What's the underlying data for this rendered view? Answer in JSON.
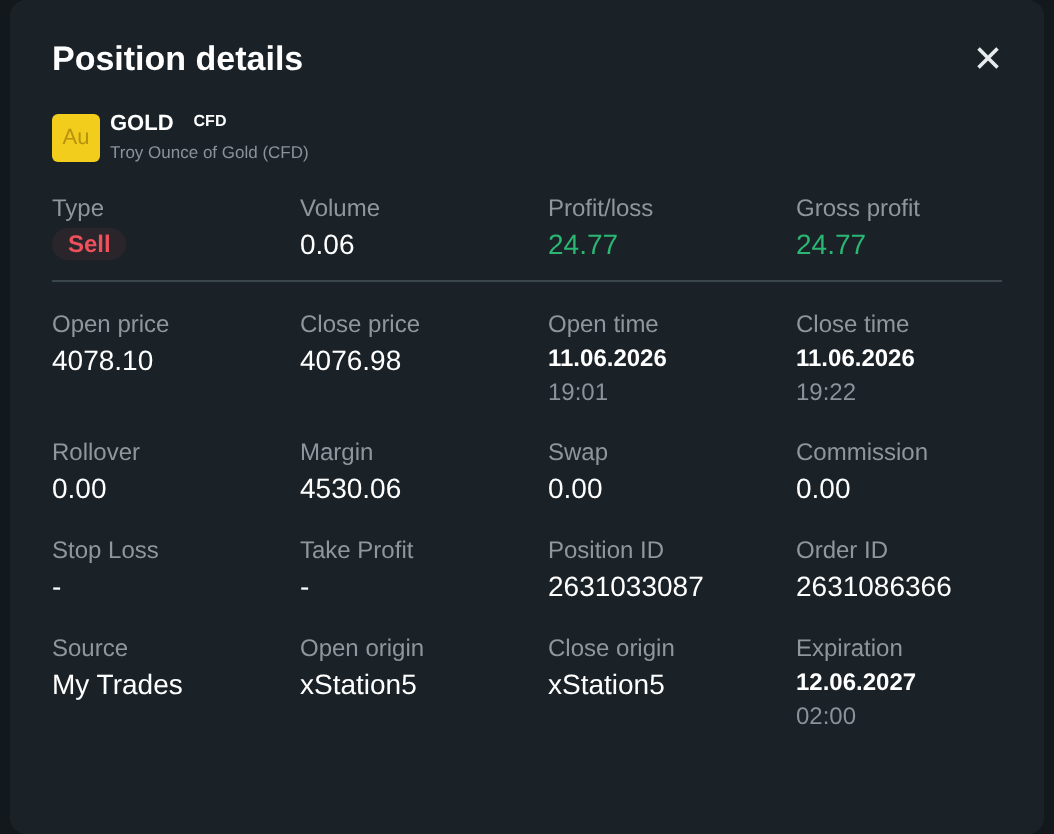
{
  "dialog": {
    "title": "Position details",
    "close_icon": "×"
  },
  "instrument": {
    "badge": "Au",
    "symbol": "GOLD",
    "tag": "CFD",
    "description": "Troy Ounce of Gold (CFD)"
  },
  "summary": [
    {
      "label": "Type",
      "value": "Sell",
      "kind": "sell"
    },
    {
      "label": "Volume",
      "value": "0.06",
      "kind": "plain"
    },
    {
      "label": "Profit/loss",
      "value": "24.77",
      "kind": "profit"
    },
    {
      "label": "Gross profit",
      "value": "24.77",
      "kind": "profit"
    }
  ],
  "details": [
    {
      "label": "Open price",
      "value": "4078.10",
      "kind": "plain"
    },
    {
      "label": "Close price",
      "value": "4076.98",
      "kind": "plain"
    },
    {
      "label": "Open time",
      "value": "11.06.2026",
      "time": "19:01",
      "kind": "datetime"
    },
    {
      "label": "Close time",
      "value": "11.06.2026",
      "time": "19:22",
      "kind": "datetime"
    },
    {
      "label": "Rollover",
      "value": "0.00",
      "kind": "plain"
    },
    {
      "label": "Margin",
      "value": "4530.06",
      "kind": "plain"
    },
    {
      "label": "Swap",
      "value": "0.00",
      "kind": "plain"
    },
    {
      "label": "Commission",
      "value": "0.00",
      "kind": "plain"
    },
    {
      "label": "Stop Loss",
      "value": "-",
      "kind": "plain"
    },
    {
      "label": "Take Profit",
      "value": "-",
      "kind": "plain"
    },
    {
      "label": "Position ID",
      "value": "2631033087",
      "kind": "plain"
    },
    {
      "label": "Order ID",
      "value": "2631086366",
      "kind": "plain"
    },
    {
      "label": "Source",
      "value": "My Trades",
      "kind": "plain"
    },
    {
      "label": "Open origin",
      "value": "xStation5",
      "kind": "plain"
    },
    {
      "label": "Close origin",
      "value": "xStation5",
      "kind": "plain"
    },
    {
      "label": "Expiration",
      "value": "12.06.2027",
      "time": "02:00",
      "kind": "datetime"
    }
  ]
}
